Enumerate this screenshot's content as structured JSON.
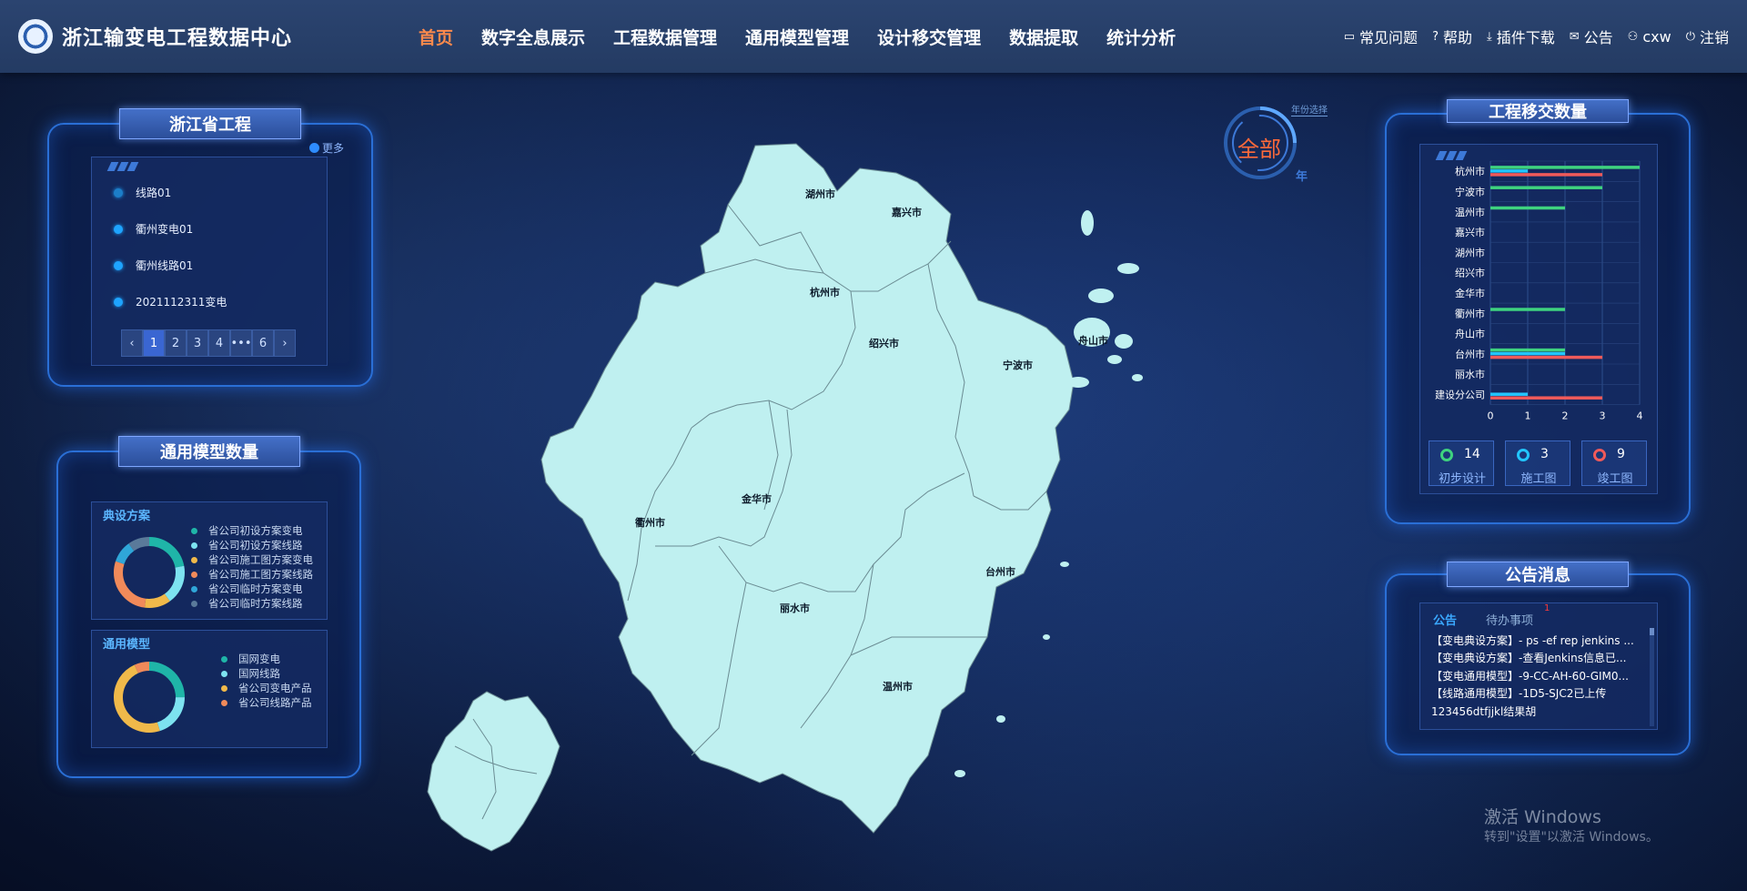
{
  "header": {
    "title": "浙江输变电工程数据中心",
    "nav": [
      "首页",
      "数字全息展示",
      "工程数据管理",
      "通用模型管理",
      "设计移交管理",
      "数据提取",
      "统计分析"
    ],
    "active_nav": "首页",
    "tools": [
      {
        "icon": "comment-icon",
        "label": "常见问题"
      },
      {
        "icon": "help-icon",
        "label": "帮助"
      },
      {
        "icon": "download-icon",
        "label": "插件下载"
      },
      {
        "icon": "mail-icon",
        "label": "公告"
      },
      {
        "icon": "user-icon",
        "label": "cxw"
      },
      {
        "icon": "power-icon",
        "label": "注销"
      }
    ]
  },
  "projects": {
    "title": "浙江省工程",
    "more": "更多",
    "items": [
      "线路01",
      "衢州变电01",
      "衢州线路01",
      "2021112311变电"
    ],
    "pages": [
      "‹",
      "1",
      "2",
      "3",
      "4",
      "•••",
      "6",
      "›"
    ],
    "active_page": "1"
  },
  "models": {
    "title": "通用模型数量",
    "typical": {
      "heading": "典设方案",
      "legend": [
        {
          "label": "省公司初设方案变电",
          "color": "#1fb5a8"
        },
        {
          "label": "省公司初设方案线路",
          "color": "#7de3f0"
        },
        {
          "label": "省公司施工图方案变电",
          "color": "#f0b94a"
        },
        {
          "label": "省公司施工图方案线路",
          "color": "#f08a5a"
        },
        {
          "label": "省公司临时方案变电",
          "color": "#2fa6d8"
        },
        {
          "label": "省公司临时方案线路",
          "color": "#5a7a9a"
        }
      ],
      "donut": [
        0.22,
        0.18,
        0.12,
        0.28,
        0.1,
        0.1
      ]
    },
    "generic": {
      "heading": "通用模型",
      "legend": [
        {
          "label": "国网变电",
          "color": "#1fb5a8"
        },
        {
          "label": "国网线路",
          "color": "#7de3f0"
        },
        {
          "label": "省公司变电产品",
          "color": "#f0b94a"
        },
        {
          "label": "省公司线路产品",
          "color": "#f08a5a"
        }
      ],
      "donut": [
        0.25,
        0.2,
        0.48,
        0.07
      ]
    }
  },
  "map": {
    "labels": [
      "湖州市",
      "嘉兴市",
      "杭州市",
      "绍兴市",
      "宁波市",
      "舟山市",
      "衢州市",
      "金华市",
      "台州市",
      "丽水市",
      "温州市"
    ],
    "year_selector": {
      "caption": "年份选择",
      "value": "全部",
      "unit": "年"
    }
  },
  "transfer": {
    "title": "工程移交数量",
    "stats": [
      {
        "value": "14",
        "label": "初步设计",
        "color": "#3ed37f"
      },
      {
        "value": "3",
        "label": "施工图",
        "color": "#22c6ff"
      },
      {
        "value": "9",
        "label": "竣工图",
        "color": "#f05a5a"
      }
    ]
  },
  "chart_data": {
    "type": "bar",
    "orientation": "horizontal",
    "categories": [
      "杭州市",
      "宁波市",
      "温州市",
      "嘉兴市",
      "湖州市",
      "绍兴市",
      "金华市",
      "衢州市",
      "舟山市",
      "台州市",
      "丽水市",
      "建设分公司"
    ],
    "series": [
      {
        "values": [
          4,
          3,
          2,
          0,
          0,
          0,
          0,
          2,
          0,
          2,
          0,
          0
        ],
        "color": "#3ed37f"
      },
      {
        "values": [
          1,
          0,
          0,
          0,
          0,
          0,
          0,
          0,
          0,
          2,
          0,
          1
        ],
        "color": "#22c6ff"
      },
      {
        "values": [
          3,
          0,
          0,
          0,
          0,
          0,
          0,
          0,
          0,
          3,
          0,
          3
        ],
        "color": "#f05a5a"
      }
    ],
    "xlim": [
      0,
      4
    ],
    "xticks": [
      "0",
      "1",
      "2",
      "3",
      "4"
    ],
    "grid": true
  },
  "notices": {
    "title": "公告消息",
    "tabs": [
      "公告",
      "待办事项"
    ],
    "todo_badge": "1",
    "lines": [
      "【变电典设方案】- ps -ef rep jenkins ...",
      "【变电典设方案】-查看Jenkins信息已...",
      "【变电通用模型】-9-CC-AH-60-GIM0...",
      "【线路通用模型】-1D5-SJC2已上传",
      "123456dtfjjkl结果胡"
    ]
  },
  "watermark": {
    "line1": "激活 Windows",
    "line2": "转到\"设置\"以激活 Windows。"
  }
}
